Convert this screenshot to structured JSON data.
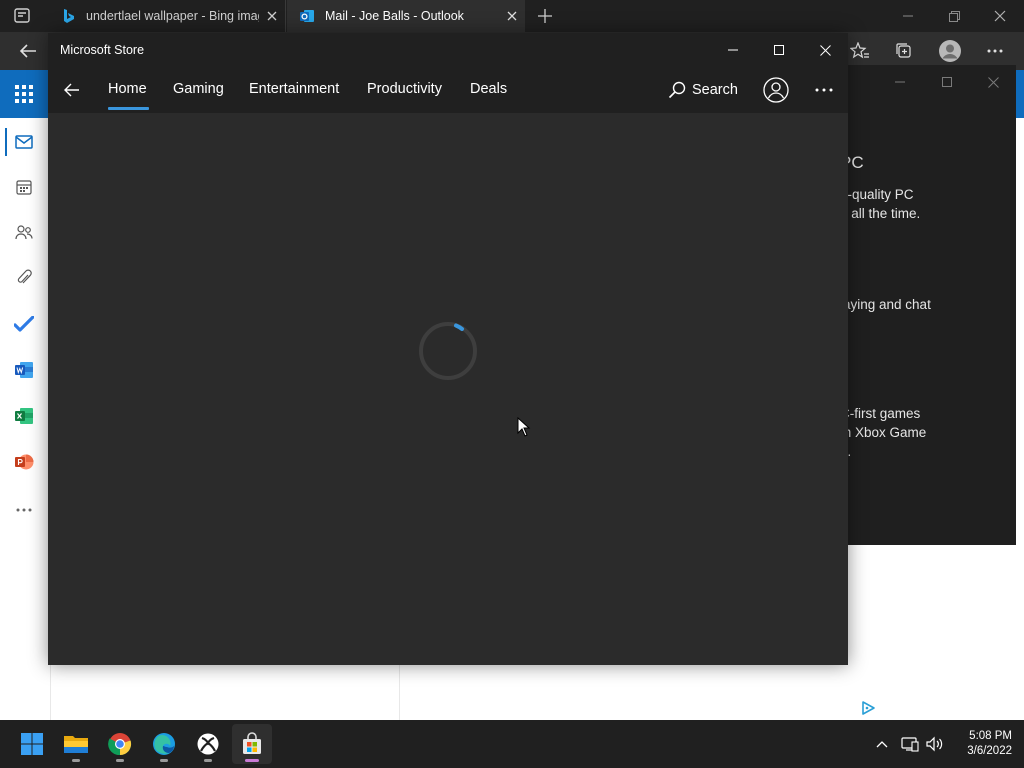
{
  "browser": {
    "tabs": [
      {
        "title": "undertlael wallpaper - Bing images",
        "favicon": "bing-icon"
      },
      {
        "title": "Mail - Joe Balls - Outlook",
        "favicon": "outlook-icon",
        "active": true
      }
    ]
  },
  "outlook": {
    "accent_color": "#0f6cbd",
    "rail_icons": [
      "mail-icon",
      "calendar-icon",
      "people-icon",
      "attachment-icon",
      "todo-icon",
      "word-icon",
      "excel-icon",
      "powerpoint-icon",
      "more-apps-icon"
    ]
  },
  "background_window": {
    "heading": "PC",
    "lines": [
      "n-quality PC",
      "d all the time.",
      "laying and chat",
      "C-first games",
      "m Xbox Game",
      "n."
    ]
  },
  "store": {
    "title": "Microsoft Store",
    "nav": [
      "Home",
      "Gaming",
      "Entertainment",
      "Productivity",
      "Deals"
    ],
    "active_nav": "Home",
    "search_label": "Search",
    "state": "loading",
    "accent_color": "#3a96dd"
  },
  "taskbar": {
    "apps": [
      "windows-start-icon",
      "file-explorer-icon",
      "chrome-icon",
      "edge-icon",
      "xbox-icon",
      "microsoft-store-icon"
    ],
    "active_app": "microsoft-store-icon",
    "clock": {
      "time": "5:08 PM",
      "date": "3/6/2022"
    }
  }
}
